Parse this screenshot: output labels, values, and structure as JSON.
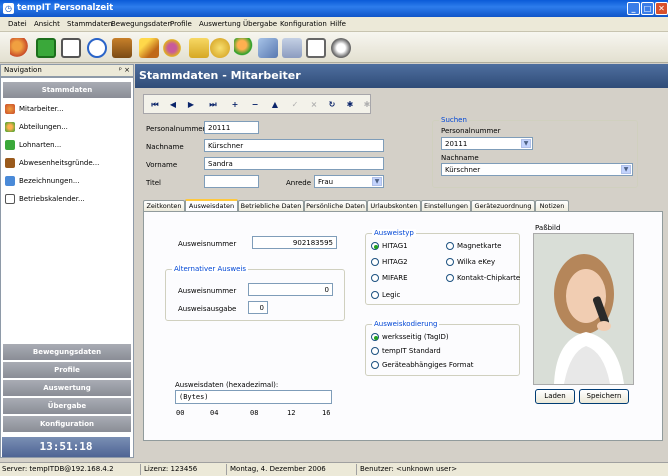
{
  "window": {
    "title": "tempIT Personalzeit"
  },
  "menu": [
    "Datei",
    "Ansicht",
    "Stammdaten",
    "Bewegungsdaten",
    "Profile",
    "Auswertung",
    "Übergabe",
    "Konfiguration",
    "Hilfe"
  ],
  "toolbar_icons": [
    "users-icon",
    "green-book-icon",
    "calendar-icon",
    "stopwatch-icon",
    "folder-icon",
    "wand-icon",
    "flowers-icon",
    "folder-open-icon",
    "coins-icon",
    "people-icon",
    "arrow-icon",
    "document-icon",
    "report-icon",
    "info-icon"
  ],
  "nav": {
    "header": "Navigation",
    "pin": "ᵖ ×",
    "section_top": "Stammdaten",
    "items": [
      "Mitarbeiter...",
      "Abteilungen...",
      "Lohnarten...",
      "Abwesenheitsgründe...",
      "Bezeichnungen...",
      "Betriebskalender..."
    ],
    "sections_bottom": [
      "Bewegungsdaten",
      "Profile",
      "Auswertung",
      "Übergabe",
      "Konfiguration"
    ],
    "clock": "13:51:18"
  },
  "main": {
    "title": "Stammdaten - Mitarbeiter"
  },
  "navigator": [
    "⏮",
    "◀",
    "▶",
    "⏭",
    "+",
    "−",
    "▲",
    "✓",
    "×",
    "↻",
    "✱",
    "✱"
  ],
  "form": {
    "personalnummer_label": "Personalnummer",
    "personalnummer": "20111",
    "nachname_label": "Nachname",
    "nachname": "Kürschner",
    "vorname_label": "Vorname",
    "vorname": "Sandra",
    "titel_label": "Titel",
    "titel": "",
    "anrede_label": "Anrede",
    "anrede": "Frau"
  },
  "search": {
    "title": "Suchen",
    "pn_label": "Personalnummer",
    "pn_value": "20111",
    "nn_label": "Nachname",
    "nn_value": "Kürschner"
  },
  "tabs": [
    "Zeitkonten",
    "Ausweisdaten",
    "Betriebliche Daten",
    "Persönliche Daten",
    "Urlaubskonten",
    "Einstellungen",
    "Gerätezuordnung",
    "Notizen"
  ],
  "ausweis": {
    "nummer_label": "Ausweisnummer",
    "nummer": "902183595",
    "alt_title": "Alternativer Ausweis",
    "alt_nummer_label": "Ausweisnummer",
    "alt_nummer": "0",
    "alt_ausgabe_label": "Ausweisausgabe",
    "alt_ausgabe": "0",
    "typ_title": "Ausweistyp",
    "typ_options": [
      "HITAG1",
      "Magnetkarte",
      "HITAG2",
      "Wilka eKey",
      "MIFARE",
      "Kontakt-Chipkarte",
      "Legic"
    ],
    "typ_selected": "HITAG1",
    "kod_title": "Ausweiskodierung",
    "kod_options": [
      "werksseitig (TagID)",
      "tempIT Standard",
      "Geräteabhängiges Format"
    ],
    "kod_selected": "werksseitig (TagID)",
    "hex_label": "Ausweisdaten (hexadezimal):",
    "hex_value": "(Bytes)",
    "hex_ticks": [
      "00",
      "04",
      "08",
      "12",
      "16"
    ],
    "photo_label": "Paßbild",
    "laden": "Laden",
    "speichern": "Speichern"
  },
  "status": {
    "server": "Server: tempITDB@192.168.4.2",
    "lizenz": "Lizenz: 123456",
    "datum": "Montag, 4. Dezember 2006",
    "benutzer": "Benutzer: <unknown user>"
  },
  "colors": {
    "titlebar": "#0a5ad8",
    "panel_header": "#2f4c78",
    "group_title": "#0046d5",
    "tab_active": "#ffc83c"
  }
}
